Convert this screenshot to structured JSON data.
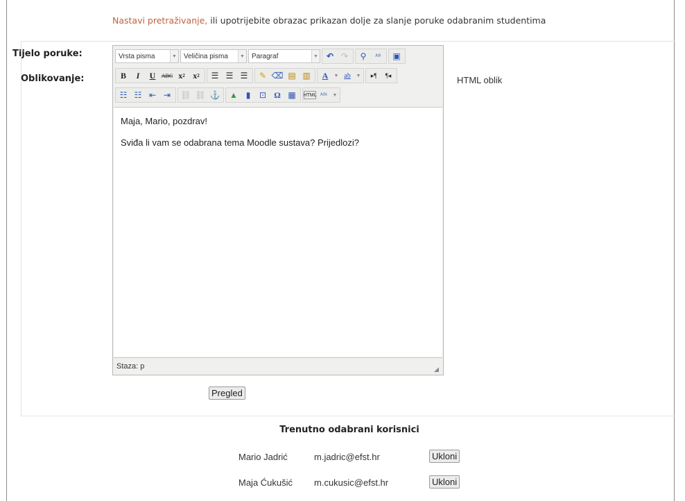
{
  "intro": {
    "link": "Nastavi pretraživanje,",
    "text": " ili upotrijebite obrazac prikazan dolje za slanje poruke odabranim studentima"
  },
  "form": {
    "body_label": "Tijelo poruke:",
    "format_label": "Oblikovanje:",
    "html_mode": "HTML oblik",
    "preview_button": "Pregled"
  },
  "editor": {
    "font_select": "Vrsta pisma",
    "size_select": "Veličina pisma",
    "paragraph_select": "Paragraf",
    "message_line1": "Maja, Mario, pozdrav!",
    "message_line2": "Sviđa li vam se odabrana tema Moodle sustava? Prijedlozi?",
    "status_path": "Staza: p"
  },
  "users": {
    "title": "Trenutno odabrani korisnici",
    "remove_label": "Ukloni",
    "rows": [
      {
        "name": "Mario Jadrić",
        "email": "m.jadric@efst.hr"
      },
      {
        "name": "Maja Ćukušić",
        "email": "m.cukusic@efst.hr"
      }
    ]
  },
  "colors": {
    "link": "#c0623d"
  }
}
